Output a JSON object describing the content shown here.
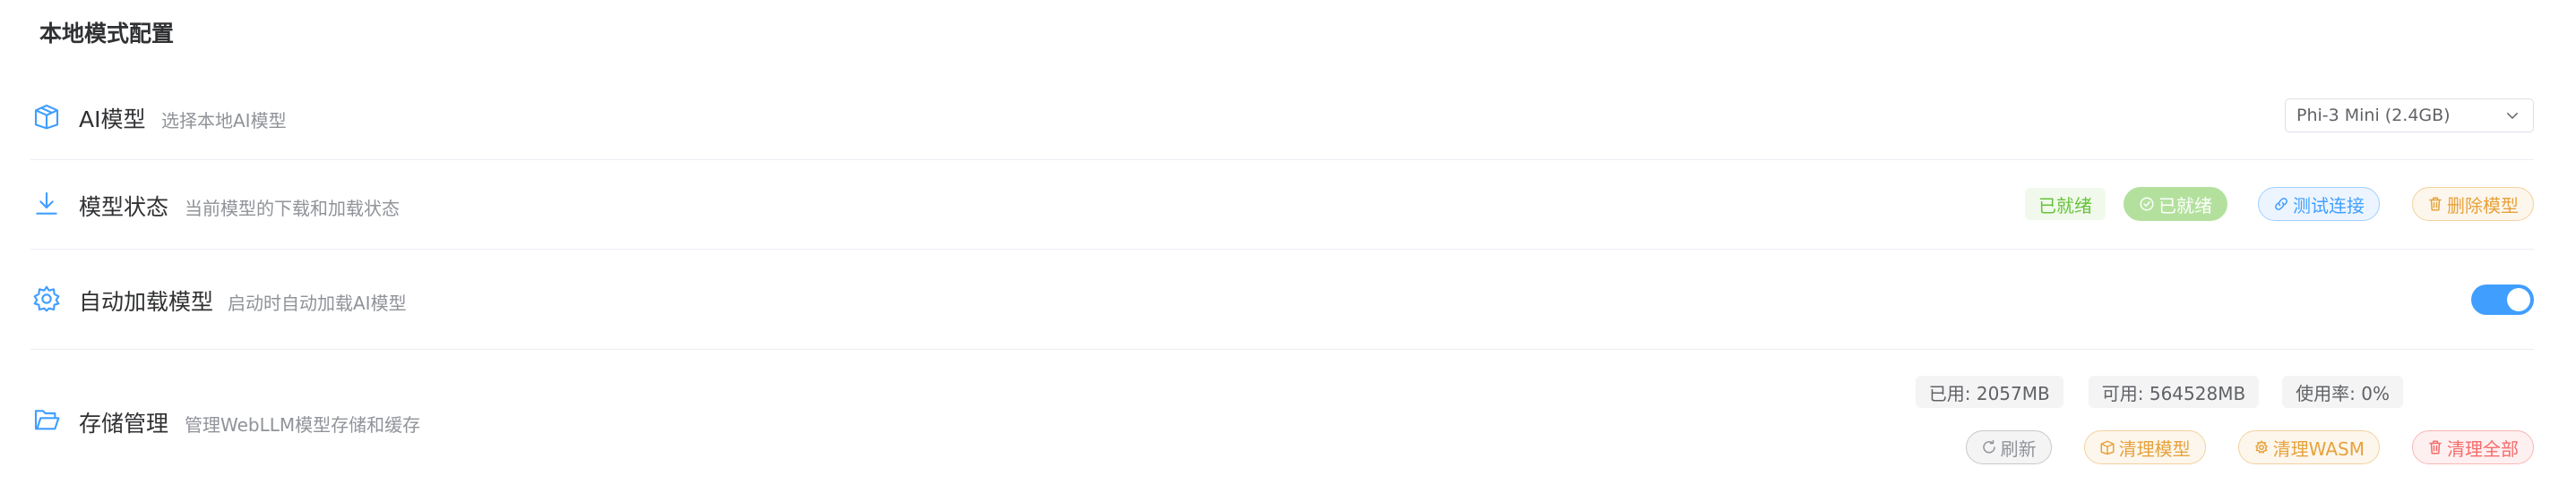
{
  "section_title": "本地模式配置",
  "colors": {
    "primary": "#409eff",
    "success": "#67c23a",
    "warning": "#e6a23c",
    "danger": "#f56c6c",
    "info": "#909399"
  },
  "rows": {
    "ai_model": {
      "icon": "package-icon",
      "title": "AI模型",
      "desc": "选择本地AI模型",
      "select_value": "Phi-3 Mini (2.4GB)"
    },
    "model_status": {
      "icon": "download-icon",
      "title": "模型状态",
      "desc": "当前模型的下载和加载状态",
      "status_tag": "已就绪",
      "ready_button": "已就绪",
      "test_button": "测试连接",
      "delete_button": "删除模型"
    },
    "auto_load": {
      "icon": "gear-icon",
      "title": "自动加载模型",
      "desc": "启动时自动加载AI模型",
      "enabled": true
    },
    "storage": {
      "icon": "folder-open-icon",
      "title": "存储管理",
      "desc": "管理WebLLM模型存储和缓存",
      "used": "已用: 2057MB",
      "available": "可用: 564528MB",
      "usage": "使用率: 0%",
      "refresh_button": "刷新",
      "clear_models_button": "清理模型",
      "clear_wasm_button": "清理WASM",
      "clear_all_button": "清理全部"
    }
  }
}
